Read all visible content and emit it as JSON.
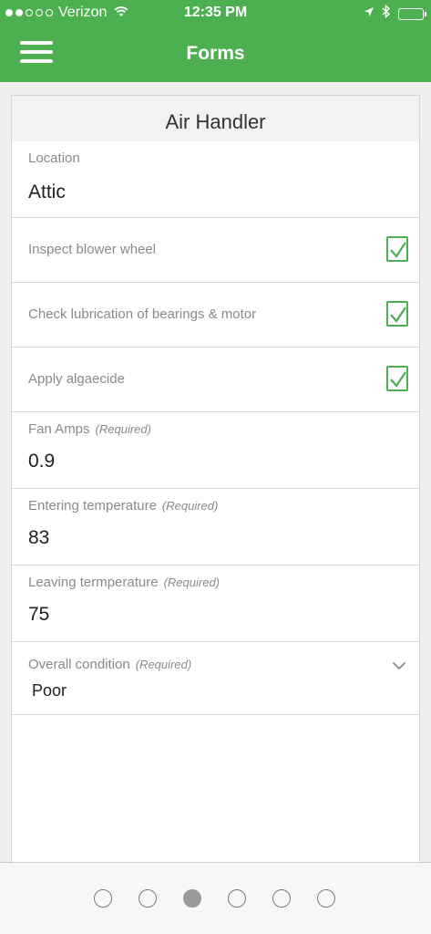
{
  "status_bar": {
    "carrier": "Verizon",
    "time": "12:35 PM",
    "signal_filled": 2,
    "signal_total": 5
  },
  "nav": {
    "title": "Forms"
  },
  "form": {
    "title": "Air Handler",
    "location": {
      "label": "Location",
      "value": "Attic"
    },
    "checks": [
      {
        "label": "Inspect blower wheel",
        "checked": true
      },
      {
        "label": "Check lubrication of bearings & motor",
        "checked": true
      },
      {
        "label": "Apply algaecide",
        "checked": true
      }
    ],
    "fan_amps": {
      "label": "Fan Amps",
      "required": "(Required)",
      "value": "0.9"
    },
    "entering_temp": {
      "label": "Entering temperature",
      "required": "(Required)",
      "value": "83"
    },
    "leaving_temp": {
      "label": "Leaving termperature",
      "required": "(Required)",
      "value": "75"
    },
    "condition": {
      "label": "Overall condition",
      "required": "(Required)",
      "value": "Poor"
    }
  },
  "pager": {
    "count": 6,
    "active_index": 2
  },
  "colors": {
    "accent": "#4caf50"
  }
}
